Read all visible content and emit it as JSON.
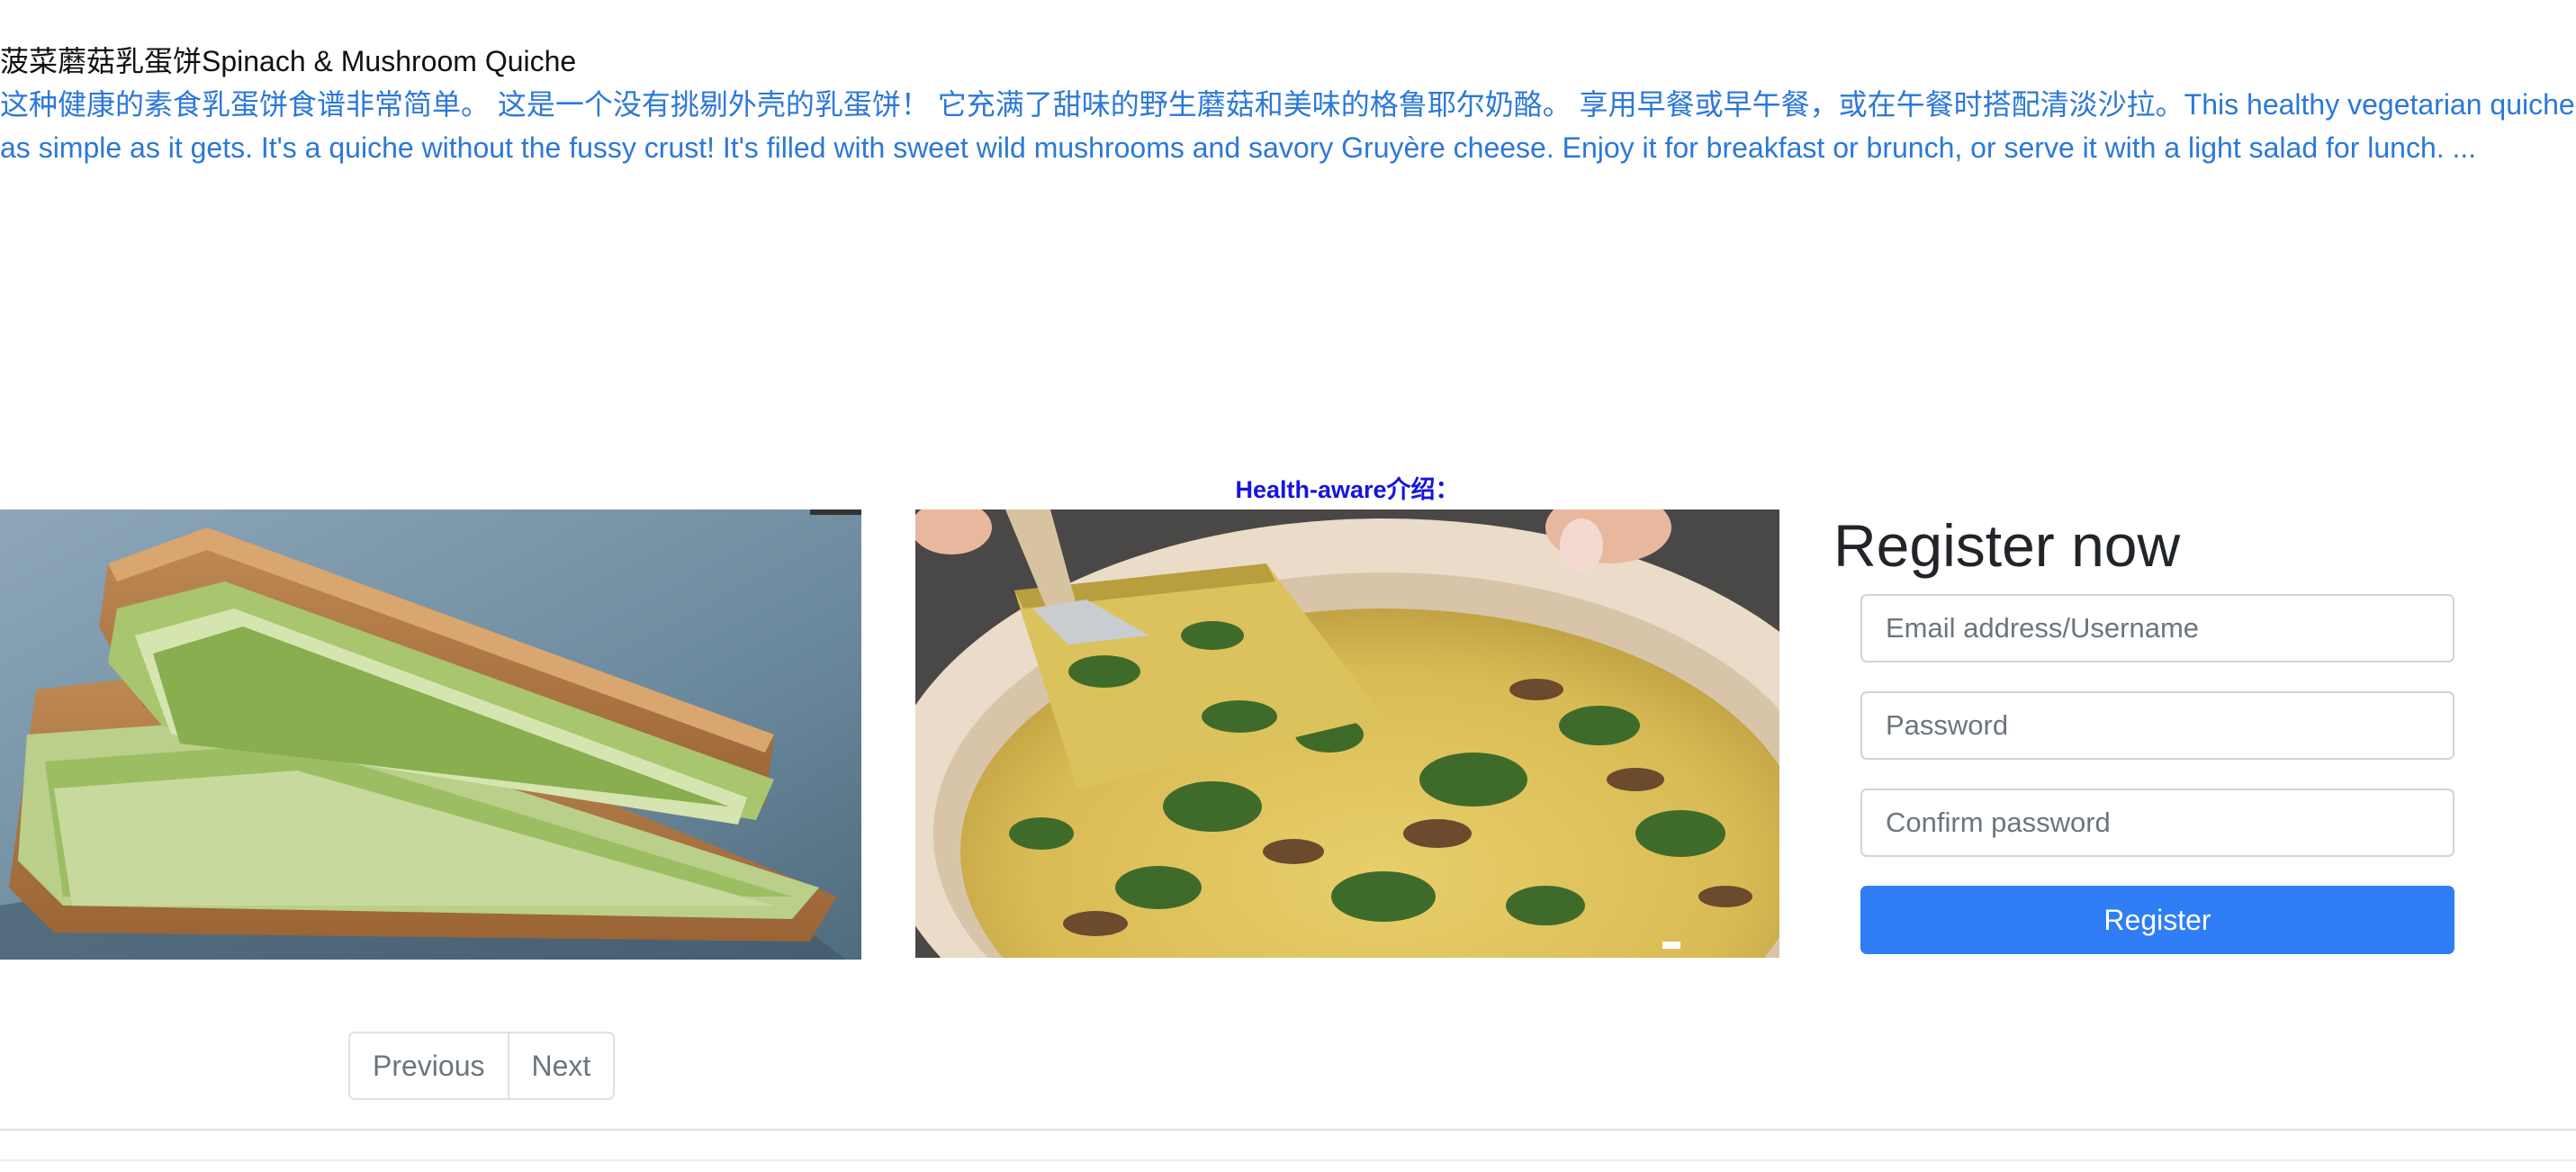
{
  "recipe": {
    "title": "菠菜蘑菇乳蛋饼Spinach & Mushroom Quiche",
    "description_line1": "这种健康的素食乳蛋饼食谱非常简单。 这是一个没有挑剔外壳的乳蛋饼！ 它充满了甜味的野生蘑菇和美味的格鲁耶尔奶酪。 享用早餐或早午餐，或在午餐时搭配清淡沙拉。This healthy vegetarian quiche recipe is",
    "description_line2": "as simple as it gets. It's a quiche without the fussy crust! It's filled with sweet wild mushrooms and savory Gruyère cheese. Enjoy it for breakfast or brunch, or serve it with a light salad for lunch. ..."
  },
  "gallery": {
    "caption": "Health-aware介绍："
  },
  "register": {
    "heading": "Register now",
    "email_placeholder": "Email address/Username",
    "password_placeholder": "Password",
    "confirm_placeholder": "Confirm password",
    "button_label": "Register"
  },
  "pagination": {
    "previous_label": "Previous",
    "next_label": "Next"
  },
  "colors": {
    "link": "#2c78d9",
    "caption": "#1414e0",
    "primary": "#2f7ef6"
  }
}
